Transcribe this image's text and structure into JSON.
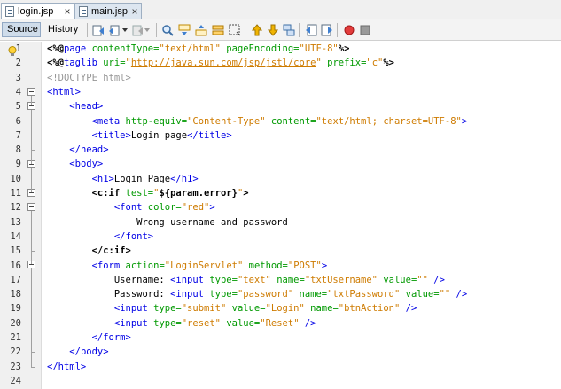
{
  "tabs": [
    {
      "label": "login.jsp",
      "active": true
    },
    {
      "label": "main.jsp",
      "active": false
    }
  ],
  "toolbar": {
    "source_label": "Source",
    "history_label": "History"
  },
  "gutter": {
    "line_numbers": [
      "1",
      "2",
      "3",
      "4",
      "5",
      "6",
      "7",
      "8",
      "9",
      "10",
      "11",
      "12",
      "13",
      "14",
      "15",
      "16",
      "17",
      "18",
      "19",
      "20",
      "21",
      "22",
      "23",
      "24"
    ]
  },
  "code": {
    "lines": [
      [
        [
          "d",
          "<%@"
        ],
        [
          "k",
          "page "
        ],
        [
          "a",
          "contentType="
        ],
        [
          "s",
          "\"text/html\""
        ],
        [
          "a",
          " pageEncoding="
        ],
        [
          "s",
          "\"UTF-8\""
        ],
        [
          "d",
          "%>"
        ]
      ],
      [
        [
          "d",
          "<%@"
        ],
        [
          "k",
          "taglib "
        ],
        [
          "a",
          "uri="
        ],
        [
          "s",
          "\""
        ],
        [
          "lnk",
          "http://java.sun.com/jsp/jstl/core"
        ],
        [
          "s",
          "\""
        ],
        [
          "a",
          " prefix="
        ],
        [
          "s",
          "\"c\""
        ],
        [
          "d",
          "%>"
        ]
      ],
      [
        [
          "c",
          "<!DOCTYPE html>"
        ]
      ],
      [
        [
          "k",
          "<html>"
        ]
      ],
      [
        [
          "t",
          "    "
        ],
        [
          "k",
          "<head>"
        ]
      ],
      [
        [
          "t",
          "        "
        ],
        [
          "k",
          "<meta "
        ],
        [
          "a",
          "http-equiv="
        ],
        [
          "s",
          "\"Content-Type\""
        ],
        [
          "a",
          " content="
        ],
        [
          "s",
          "\"text/html; charset=UTF-8\""
        ],
        [
          "k",
          ">"
        ]
      ],
      [
        [
          "t",
          "        "
        ],
        [
          "k",
          "<title>"
        ],
        [
          "t",
          "Login page"
        ],
        [
          "k",
          "</title>"
        ]
      ],
      [
        [
          "t",
          "    "
        ],
        [
          "k",
          "</head>"
        ]
      ],
      [
        [
          "t",
          "    "
        ],
        [
          "k",
          "<body>"
        ]
      ],
      [
        [
          "t",
          "        "
        ],
        [
          "k",
          "<h1>"
        ],
        [
          "t",
          "Login Page"
        ],
        [
          "k",
          "</h1>"
        ]
      ],
      [
        [
          "t",
          "        "
        ],
        [
          "d",
          "<c:if "
        ],
        [
          "a",
          "test="
        ],
        [
          "s",
          "\""
        ],
        [
          "d",
          "${param.error}"
        ],
        [
          "s",
          "\""
        ],
        [
          "d",
          ">"
        ]
      ],
      [
        [
          "t",
          "            "
        ],
        [
          "k",
          "<font "
        ],
        [
          "a",
          "color="
        ],
        [
          "s",
          "\"red\""
        ],
        [
          "k",
          ">"
        ]
      ],
      [
        [
          "t",
          "                Wrong username and password"
        ]
      ],
      [
        [
          "t",
          "            "
        ],
        [
          "k",
          "</font>"
        ]
      ],
      [
        [
          "t",
          "        "
        ],
        [
          "d",
          "</c:if>"
        ]
      ],
      [
        [
          "t",
          "        "
        ],
        [
          "k",
          "<form "
        ],
        [
          "a",
          "action="
        ],
        [
          "s",
          "\"LoginServlet\""
        ],
        [
          "a",
          " method="
        ],
        [
          "s",
          "\"POST\""
        ],
        [
          "k",
          ">"
        ]
      ],
      [
        [
          "t",
          "            Username: "
        ],
        [
          "k",
          "<input "
        ],
        [
          "a",
          "type="
        ],
        [
          "s",
          "\"text\""
        ],
        [
          "a",
          " name="
        ],
        [
          "s",
          "\"txtUsername\""
        ],
        [
          "a",
          " value="
        ],
        [
          "s",
          "\"\""
        ],
        [
          "k",
          " />"
        ]
      ],
      [
        [
          "t",
          "            Password: "
        ],
        [
          "k",
          "<input "
        ],
        [
          "a",
          "type="
        ],
        [
          "s",
          "\"password\""
        ],
        [
          "a",
          " name="
        ],
        [
          "s",
          "\"txtPassword\""
        ],
        [
          "a",
          " value="
        ],
        [
          "s",
          "\"\""
        ],
        [
          "k",
          " />"
        ]
      ],
      [
        [
          "t",
          "            "
        ],
        [
          "k",
          "<input "
        ],
        [
          "a",
          "type="
        ],
        [
          "s",
          "\"submit\""
        ],
        [
          "a",
          " value="
        ],
        [
          "s",
          "\"Login\""
        ],
        [
          "a",
          " name="
        ],
        [
          "s",
          "\"btnAction\""
        ],
        [
          "k",
          " />"
        ]
      ],
      [
        [
          "t",
          "            "
        ],
        [
          "k",
          "<input "
        ],
        [
          "a",
          "type="
        ],
        [
          "s",
          "\"reset\""
        ],
        [
          "a",
          " value="
        ],
        [
          "s",
          "\"Reset\""
        ],
        [
          "k",
          " />"
        ]
      ],
      [
        [
          "t",
          "        "
        ],
        [
          "k",
          "</form>"
        ]
      ],
      [
        [
          "t",
          "    "
        ],
        [
          "k",
          "</body>"
        ]
      ],
      [
        [
          "k",
          "</html>"
        ]
      ],
      []
    ]
  },
  "colors": {
    "tag": "#0000e6",
    "attribute": "#009900",
    "string": "#ce7b00",
    "comment": "#969696"
  }
}
